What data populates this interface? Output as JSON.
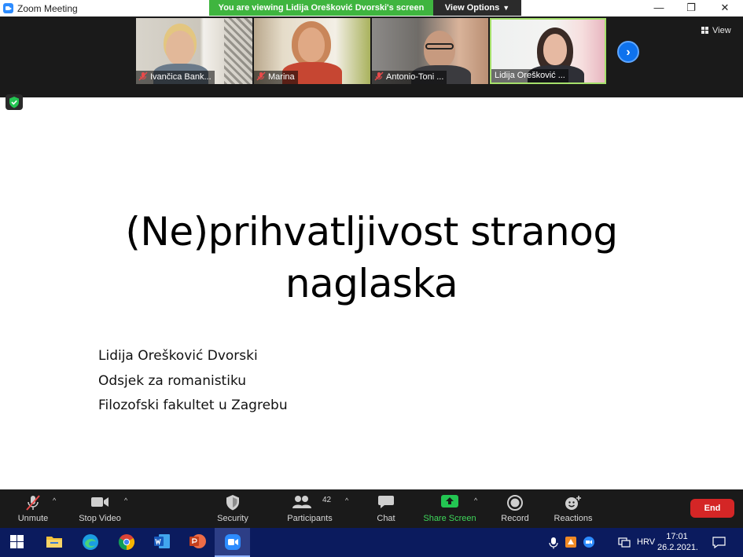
{
  "window": {
    "title": "Zoom Meeting",
    "viewing_banner": "You are viewing Lidija Orešković Dvorski's screen",
    "view_options": "View Options",
    "minimize": "—",
    "restore": "❐",
    "close": "✕"
  },
  "gallery": {
    "participants": [
      {
        "name": "Ivančica Bank..."
      },
      {
        "name": "Marina"
      },
      {
        "name": "Antonio-Toni ..."
      },
      {
        "name": "Lidija Orešković ..."
      }
    ],
    "view_label": "View"
  },
  "slide": {
    "title_line1": "(Ne)prihvatljivost stranog",
    "title_line2": "naglaska",
    "author": "Lidija Orešković Dvorski",
    "department": "Odsjek za romanistiku",
    "faculty": "Filozofski fakultet u Zagrebu"
  },
  "toolbar": {
    "unmute": "Unmute",
    "stop_video": "Stop Video",
    "security": "Security",
    "participants": "Participants",
    "participants_count": "42",
    "chat": "Chat",
    "share_screen": "Share Screen",
    "record": "Record",
    "reactions": "Reactions",
    "end": "End"
  },
  "taskbar": {
    "language": "HRV",
    "time": "17:01",
    "date": "26.2.2021."
  },
  "colors": {
    "banner_green": "#3fb53f",
    "zoom_blue": "#2d8cff",
    "end_red": "#d42626",
    "share_green": "#3fd75b",
    "taskbar_navy": "#0b1b5e"
  }
}
